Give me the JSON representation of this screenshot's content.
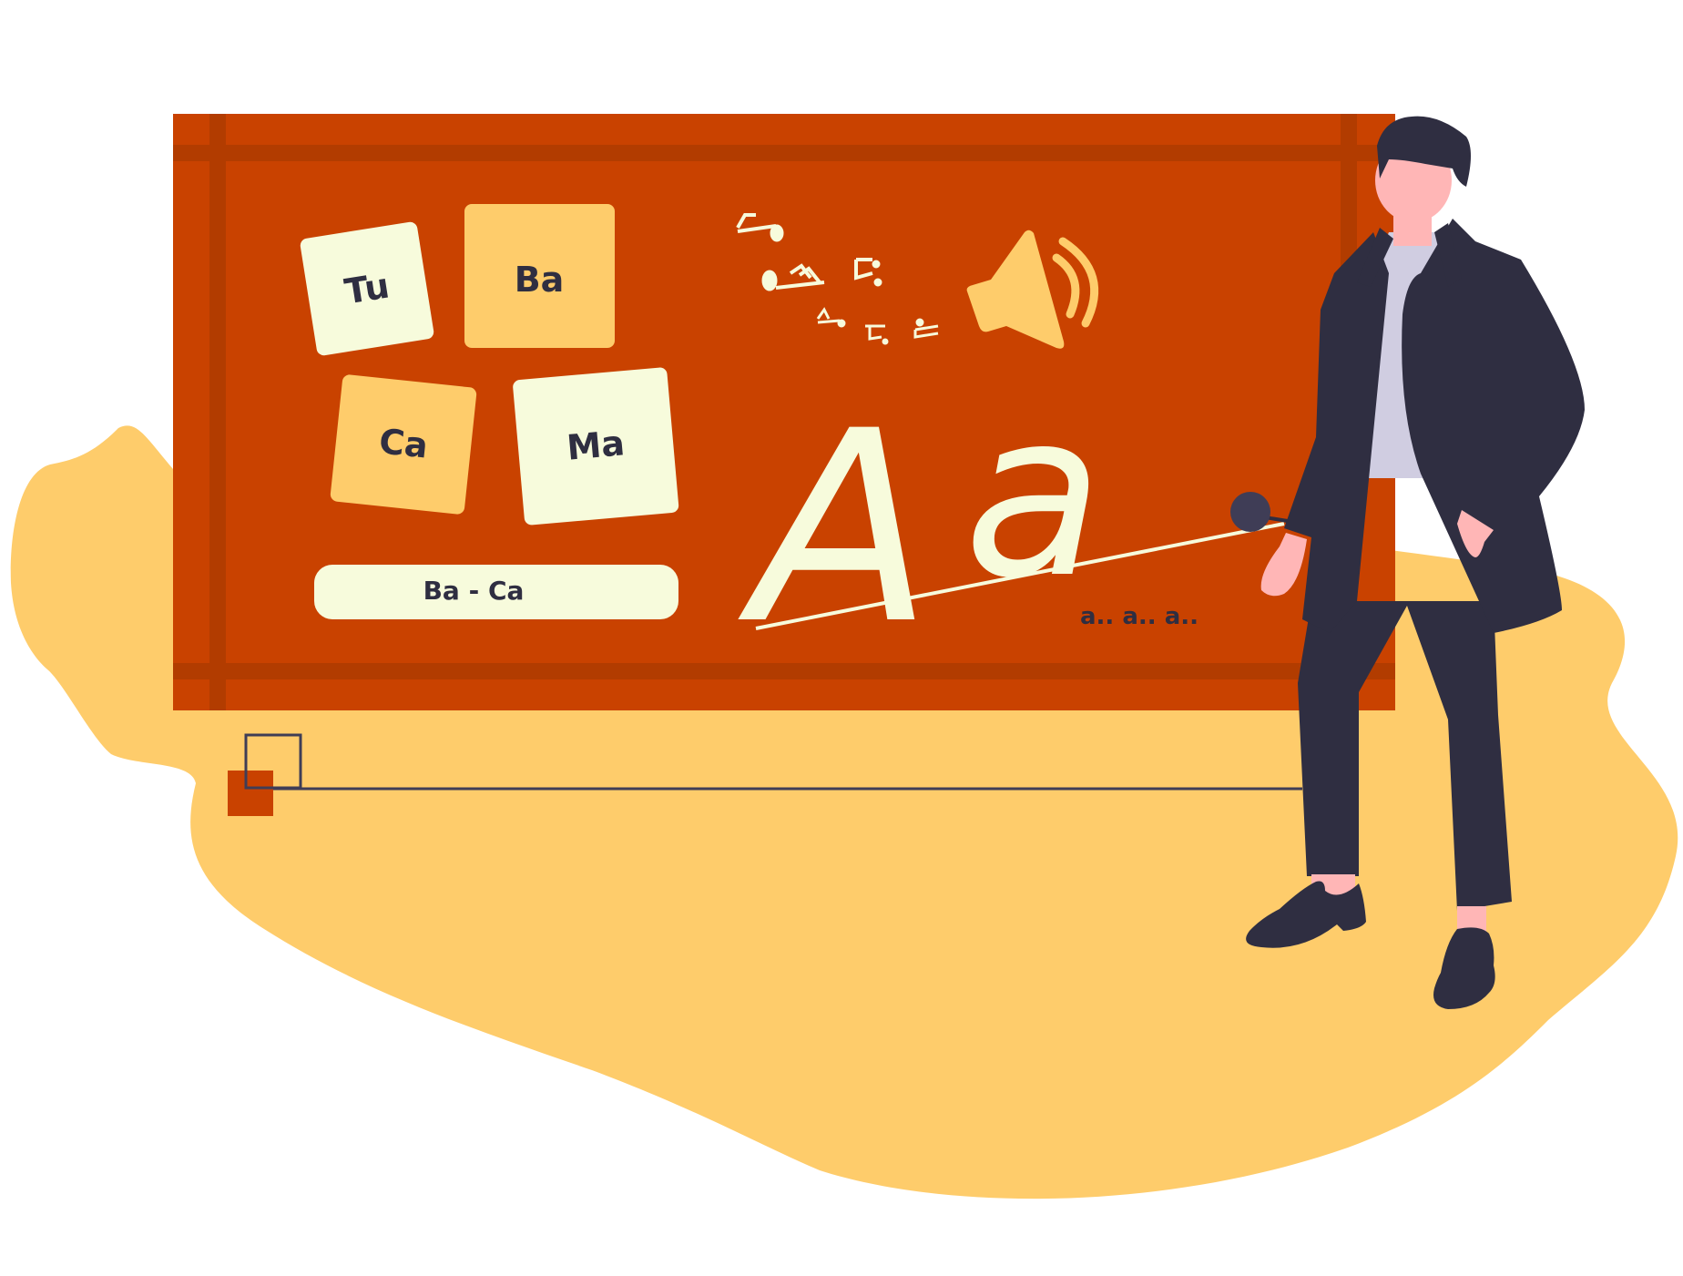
{
  "tiles": {
    "tu": "Tu",
    "ba": "Ba",
    "ca": "Ca",
    "ma": "Ma"
  },
  "syllable_bar": "Ba - Ca",
  "big_letters": {
    "upper": "A",
    "lower": "a"
  },
  "sound_text": "a.. a.. a..",
  "colors": {
    "board": "#c94200",
    "board_frame": "#b23c00",
    "blob": "#fecc6b",
    "tile_light": "#f7fbdc",
    "tile_warm": "#fecc6b",
    "ink": "#2f2e41",
    "speaker": "#fecc6b",
    "skin": "#ffb6b6",
    "shirt": "#d0cde1"
  },
  "icons": [
    "speaker-icon",
    "music-note-icon"
  ]
}
